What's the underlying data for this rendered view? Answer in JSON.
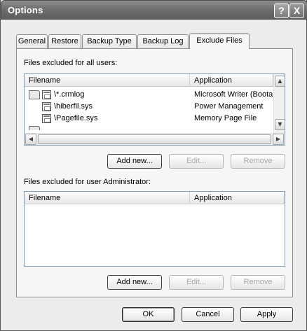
{
  "window": {
    "title": "Options",
    "help_icon": "?",
    "close_icon": "X"
  },
  "tabs": [
    {
      "label": "General",
      "active": false
    },
    {
      "label": "Restore",
      "active": false
    },
    {
      "label": "Backup Type",
      "active": false
    },
    {
      "label": "Backup Log",
      "active": false
    },
    {
      "label": "Exclude Files",
      "active": true
    }
  ],
  "all_users": {
    "label": "Files excluded for all users:",
    "columns": {
      "filename": "Filename",
      "application": "Application"
    },
    "rows": [
      {
        "icon": "folder-icon",
        "filename": "\\*.crmlog",
        "application": "Microsoft Writer (Boota"
      },
      {
        "icon": "file-icon",
        "filename": "\\hiberfil.sys",
        "application": "Power Management"
      },
      {
        "icon": "file-icon",
        "filename": "\\Pagefile.sys",
        "application": "Memory Page File"
      }
    ],
    "buttons": {
      "add": "Add new...",
      "edit": "Edit...",
      "remove": "Remove"
    }
  },
  "user_admin": {
    "label": "Files excluded for user Administrator:",
    "columns": {
      "filename": "Filename",
      "application": "Application"
    },
    "rows": [],
    "buttons": {
      "add": "Add new...",
      "edit": "Edit...",
      "remove": "Remove"
    }
  },
  "footer": {
    "ok": "OK",
    "cancel": "Cancel",
    "apply": "Apply"
  }
}
